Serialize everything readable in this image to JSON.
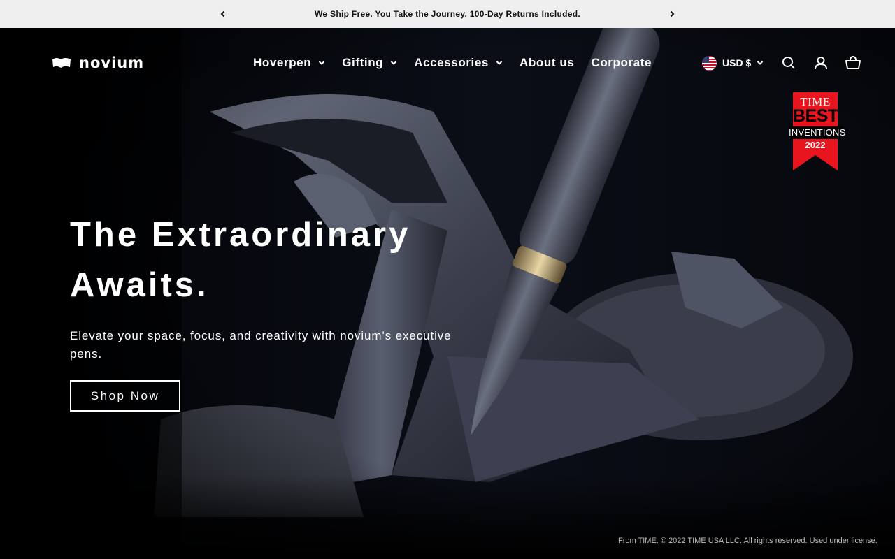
{
  "announcement": {
    "text": "We Ship Free. You Take the Journey. 100-Day Returns Included.",
    "prev_icon": "chevron-left-icon",
    "next_icon": "chevron-right-icon"
  },
  "header": {
    "logo_text": "novium",
    "nav": [
      {
        "label": "Hoverpen",
        "has_dropdown": true
      },
      {
        "label": "Gifting",
        "has_dropdown": true
      },
      {
        "label": "Accessories",
        "has_dropdown": true
      },
      {
        "label": "About us",
        "has_dropdown": false
      },
      {
        "label": "Corporate",
        "has_dropdown": false
      }
    ],
    "currency": {
      "label": "USD $",
      "flag_icon": "us-flag-icon"
    },
    "icons": [
      "search-icon",
      "account-icon",
      "cart-icon"
    ]
  },
  "badge": {
    "line1": "TIME",
    "line2": "BEST",
    "line3": "INVENTIONS",
    "line4": "2022",
    "color": "#e8141e"
  },
  "hero": {
    "headline_line1": "The Extraordinary",
    "headline_line2": "Awaits.",
    "subtext": "Elevate your space, focus, and creativity with novium's executive pens.",
    "cta": "Shop Now",
    "credit": "From TIME. © 2022 TIME USA LLC. All rights reserved. Used under license."
  }
}
